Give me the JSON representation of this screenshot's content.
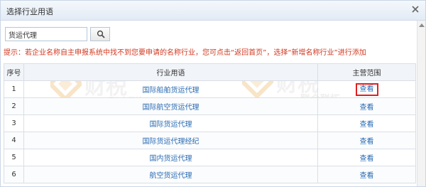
{
  "dialog": {
    "title": "选择行业用语",
    "close_icon": "close-icon"
  },
  "search": {
    "value": "货运代理",
    "button_icon": "search-icon"
  },
  "tip": "提示：若企业名称自主申报系统中找不到您要申请的名称行业，您可点击“返回首页”，选择“新增名称行业”进行添加",
  "watermark": {
    "big": "财税",
    "small": "联合联拓"
  },
  "table": {
    "columns": [
      "序号",
      "行业用语",
      "主营范围"
    ],
    "rows": [
      {
        "no": "1",
        "name": "国际船舶货运代理",
        "action": "查看"
      },
      {
        "no": "2",
        "name": "国际航空货运代理",
        "action": "查看"
      },
      {
        "no": "3",
        "name": "国际货运代理",
        "action": "查看"
      },
      {
        "no": "4",
        "name": "国际货运代理经纪",
        "action": "查看"
      },
      {
        "no": "5",
        "name": "国内货运代理",
        "action": "查看"
      },
      {
        "no": "6",
        "name": "航空货运代理",
        "action": "查看"
      }
    ]
  },
  "colors": {
    "tip_text": "#d2381f",
    "link": "#2a6bb3",
    "highlight_box": "#e02020",
    "header_bg": "#f1f4f8"
  }
}
